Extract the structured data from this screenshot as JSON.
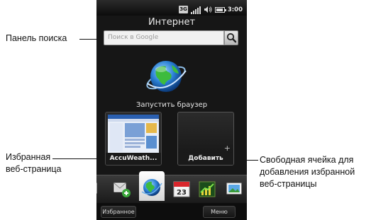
{
  "callouts": {
    "search_panel": "Панель поиска",
    "favorite_line1": "Избранная",
    "favorite_line2": "веб-страница",
    "free_slot_line1": "Свободная ячейка для",
    "free_slot_line2": "добавления избранной",
    "free_slot_line3": "веб-страницы"
  },
  "status_bar": {
    "network": "3G",
    "time": "3:00",
    "icons": [
      "network-3g-icon",
      "signal-icon",
      "speaker-icon",
      "battery-icon"
    ]
  },
  "screen": {
    "title": "Интернет",
    "search": {
      "placeholder": "Поиск в Google"
    },
    "launch_label": "Запустить браузер",
    "favorites": [
      {
        "label": "AccuWeath..."
      },
      {
        "label": "Добавить"
      }
    ],
    "tabs": [
      "messaging-icon",
      "internet-globe-icon",
      "calendar-icon",
      "stocks-icon",
      "photos-icon"
    ],
    "calendar_day": "23",
    "softkeys": {
      "left": "Избранное",
      "right": "Меню"
    }
  },
  "colors": {
    "background": "#161616",
    "accent_blue": "#2a7fd4",
    "green": "#2fae3a"
  }
}
